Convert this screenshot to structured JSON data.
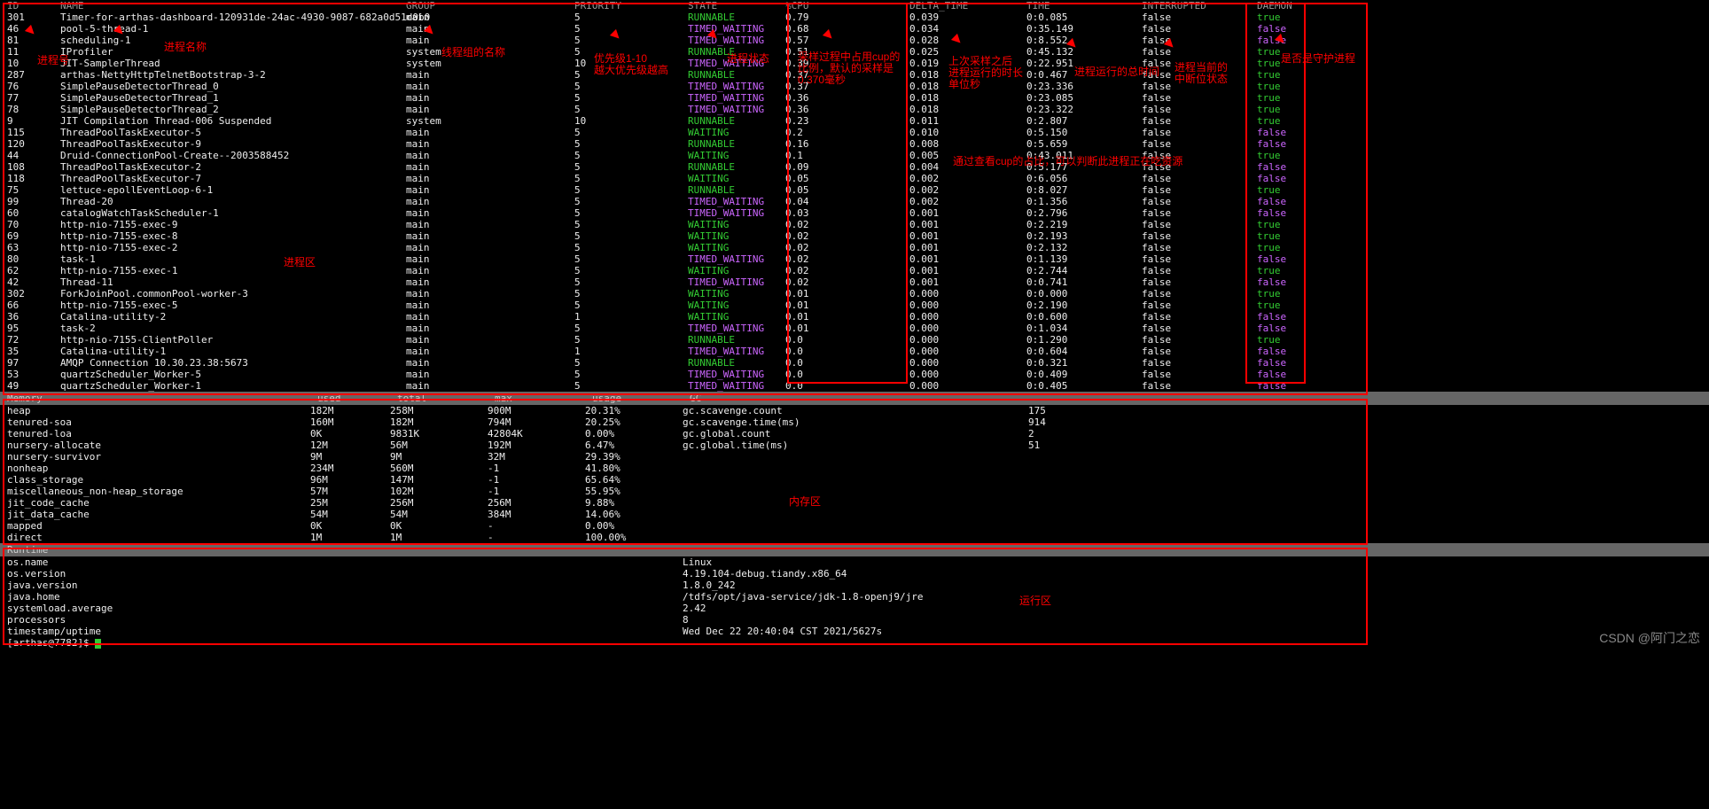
{
  "headers": [
    "ID",
    "NAME",
    "GROUP",
    "PRIORITY",
    "STATE",
    "%CPU",
    "DELTA_TIME",
    "TIME",
    "INTERRUPTED",
    "DAEMON"
  ],
  "threads": [
    {
      "id": "301",
      "name": "Timer-for-arthas-dashboard-120931de-24ac-4930-9087-682a0d51d0b0",
      "group": "main",
      "pri": "5",
      "state": "RUNNABLE",
      "sc": "green",
      "cpu": "0.79",
      "delta": "0.039",
      "time": "0:0.085",
      "int": "false",
      "dae": "true",
      "dc": "green"
    },
    {
      "id": "46",
      "name": "pool-5-thread-1",
      "group": "main",
      "pri": "5",
      "state": "TIMED_WAITING",
      "sc": "purple",
      "cpu": "0.68",
      "delta": "0.034",
      "time": "0:35.149",
      "int": "false",
      "dae": "false",
      "dc": "purple"
    },
    {
      "id": "81",
      "name": "scheduling-1",
      "group": "main",
      "pri": "5",
      "state": "TIMED_WAITING",
      "sc": "purple",
      "cpu": "0.57",
      "delta": "0.028",
      "time": "0:8.552",
      "int": "false",
      "dae": "false",
      "dc": "purple"
    },
    {
      "id": "11",
      "name": "IProfiler",
      "group": "system",
      "pri": "5",
      "state": "RUNNABLE",
      "sc": "green",
      "cpu": "0.51",
      "delta": "0.025",
      "time": "0:45.132",
      "int": "false",
      "dae": "true",
      "dc": "green"
    },
    {
      "id": "10",
      "name": "JIT-SamplerThread",
      "group": "system",
      "pri": "10",
      "state": "TIMED_WAITING",
      "sc": "purple",
      "cpu": "0.39",
      "delta": "0.019",
      "time": "0:22.951",
      "int": "false",
      "dae": "true",
      "dc": "green"
    },
    {
      "id": "287",
      "name": "arthas-NettyHttpTelnetBootstrap-3-2",
      "group": "main",
      "pri": "5",
      "state": "RUNNABLE",
      "sc": "green",
      "cpu": "0.37",
      "delta": "0.018",
      "time": "0:0.467",
      "int": "false",
      "dae": "true",
      "dc": "green"
    },
    {
      "id": "76",
      "name": "SimplePauseDetectorThread_0",
      "group": "main",
      "pri": "5",
      "state": "TIMED_WAITING",
      "sc": "purple",
      "cpu": "0.37",
      "delta": "0.018",
      "time": "0:23.336",
      "int": "false",
      "dae": "true",
      "dc": "green"
    },
    {
      "id": "77",
      "name": "SimplePauseDetectorThread_1",
      "group": "main",
      "pri": "5",
      "state": "TIMED_WAITING",
      "sc": "purple",
      "cpu": "0.36",
      "delta": "0.018",
      "time": "0:23.085",
      "int": "false",
      "dae": "true",
      "dc": "green"
    },
    {
      "id": "78",
      "name": "SimplePauseDetectorThread_2",
      "group": "main",
      "pri": "5",
      "state": "TIMED_WAITING",
      "sc": "purple",
      "cpu": "0.36",
      "delta": "0.018",
      "time": "0:23.322",
      "int": "false",
      "dae": "true",
      "dc": "green"
    },
    {
      "id": "9",
      "name": "JIT Compilation Thread-006 Suspended",
      "group": "system",
      "pri": "10",
      "state": "RUNNABLE",
      "sc": "green",
      "cpu": "0.23",
      "delta": "0.011",
      "time": "0:2.807",
      "int": "false",
      "dae": "true",
      "dc": "green"
    },
    {
      "id": "115",
      "name": "ThreadPoolTaskExecutor-5",
      "group": "main",
      "pri": "5",
      "state": "WAITING",
      "sc": "green",
      "cpu": "0.2",
      "delta": "0.010",
      "time": "0:5.150",
      "int": "false",
      "dae": "false",
      "dc": "purple"
    },
    {
      "id": "120",
      "name": "ThreadPoolTaskExecutor-9",
      "group": "main",
      "pri": "5",
      "state": "RUNNABLE",
      "sc": "green",
      "cpu": "0.16",
      "delta": "0.008",
      "time": "0:5.659",
      "int": "false",
      "dae": "false",
      "dc": "purple"
    },
    {
      "id": "44",
      "name": "Druid-ConnectionPool-Create--2003588452",
      "group": "main",
      "pri": "5",
      "state": "WAITING",
      "sc": "green",
      "cpu": "0.1",
      "delta": "0.005",
      "time": "0:43.011",
      "int": "false",
      "dae": "true",
      "dc": "green"
    },
    {
      "id": "108",
      "name": "ThreadPoolTaskExecutor-2",
      "group": "main",
      "pri": "5",
      "state": "RUNNABLE",
      "sc": "green",
      "cpu": "0.09",
      "delta": "0.004",
      "time": "0:5.177",
      "int": "false",
      "dae": "false",
      "dc": "purple"
    },
    {
      "id": "118",
      "name": "ThreadPoolTaskExecutor-7",
      "group": "main",
      "pri": "5",
      "state": "WAITING",
      "sc": "green",
      "cpu": "0.05",
      "delta": "0.002",
      "time": "0:6.056",
      "int": "false",
      "dae": "false",
      "dc": "purple"
    },
    {
      "id": "75",
      "name": "lettuce-epollEventLoop-6-1",
      "group": "main",
      "pri": "5",
      "state": "RUNNABLE",
      "sc": "green",
      "cpu": "0.05",
      "delta": "0.002",
      "time": "0:8.027",
      "int": "false",
      "dae": "true",
      "dc": "green"
    },
    {
      "id": "99",
      "name": "Thread-20",
      "group": "main",
      "pri": "5",
      "state": "TIMED_WAITING",
      "sc": "purple",
      "cpu": "0.04",
      "delta": "0.002",
      "time": "0:1.356",
      "int": "false",
      "dae": "false",
      "dc": "purple"
    },
    {
      "id": "60",
      "name": "catalogWatchTaskScheduler-1",
      "group": "main",
      "pri": "5",
      "state": "TIMED_WAITING",
      "sc": "purple",
      "cpu": "0.03",
      "delta": "0.001",
      "time": "0:2.796",
      "int": "false",
      "dae": "false",
      "dc": "purple"
    },
    {
      "id": "70",
      "name": "http-nio-7155-exec-9",
      "group": "main",
      "pri": "5",
      "state": "WAITING",
      "sc": "green",
      "cpu": "0.02",
      "delta": "0.001",
      "time": "0:2.219",
      "int": "false",
      "dae": "true",
      "dc": "green"
    },
    {
      "id": "69",
      "name": "http-nio-7155-exec-8",
      "group": "main",
      "pri": "5",
      "state": "WAITING",
      "sc": "green",
      "cpu": "0.02",
      "delta": "0.001",
      "time": "0:2.193",
      "int": "false",
      "dae": "true",
      "dc": "green"
    },
    {
      "id": "63",
      "name": "http-nio-7155-exec-2",
      "group": "main",
      "pri": "5",
      "state": "WAITING",
      "sc": "green",
      "cpu": "0.02",
      "delta": "0.001",
      "time": "0:2.132",
      "int": "false",
      "dae": "true",
      "dc": "green"
    },
    {
      "id": "80",
      "name": "task-1",
      "group": "main",
      "pri": "5",
      "state": "TIMED_WAITING",
      "sc": "purple",
      "cpu": "0.02",
      "delta": "0.001",
      "time": "0:1.139",
      "int": "false",
      "dae": "false",
      "dc": "purple"
    },
    {
      "id": "62",
      "name": "http-nio-7155-exec-1",
      "group": "main",
      "pri": "5",
      "state": "WAITING",
      "sc": "green",
      "cpu": "0.02",
      "delta": "0.001",
      "time": "0:2.744",
      "int": "false",
      "dae": "true",
      "dc": "green"
    },
    {
      "id": "42",
      "name": "Thread-11",
      "group": "main",
      "pri": "5",
      "state": "TIMED_WAITING",
      "sc": "purple",
      "cpu": "0.02",
      "delta": "0.001",
      "time": "0:0.741",
      "int": "false",
      "dae": "false",
      "dc": "purple"
    },
    {
      "id": "302",
      "name": "ForkJoinPool.commonPool-worker-3",
      "group": "main",
      "pri": "5",
      "state": "WAITING",
      "sc": "green",
      "cpu": "0.01",
      "delta": "0.000",
      "time": "0:0.000",
      "int": "false",
      "dae": "true",
      "dc": "green"
    },
    {
      "id": "66",
      "name": "http-nio-7155-exec-5",
      "group": "main",
      "pri": "5",
      "state": "WAITING",
      "sc": "green",
      "cpu": "0.01",
      "delta": "0.000",
      "time": "0:2.190",
      "int": "false",
      "dae": "true",
      "dc": "green"
    },
    {
      "id": "36",
      "name": "Catalina-utility-2",
      "group": "main",
      "pri": "1",
      "state": "WAITING",
      "sc": "green",
      "cpu": "0.01",
      "delta": "0.000",
      "time": "0:0.600",
      "int": "false",
      "dae": "false",
      "dc": "purple"
    },
    {
      "id": "95",
      "name": "task-2",
      "group": "main",
      "pri": "5",
      "state": "TIMED_WAITING",
      "sc": "purple",
      "cpu": "0.01",
      "delta": "0.000",
      "time": "0:1.034",
      "int": "false",
      "dae": "false",
      "dc": "purple"
    },
    {
      "id": "72",
      "name": "http-nio-7155-ClientPoller",
      "group": "main",
      "pri": "5",
      "state": "RUNNABLE",
      "sc": "green",
      "cpu": "0.0",
      "delta": "0.000",
      "time": "0:1.290",
      "int": "false",
      "dae": "true",
      "dc": "green"
    },
    {
      "id": "35",
      "name": "Catalina-utility-1",
      "group": "main",
      "pri": "1",
      "state": "TIMED_WAITING",
      "sc": "purple",
      "cpu": "0.0",
      "delta": "0.000",
      "time": "0:0.604",
      "int": "false",
      "dae": "false",
      "dc": "purple"
    },
    {
      "id": "97",
      "name": "AMQP Connection 10.30.23.38:5673",
      "group": "main",
      "pri": "5",
      "state": "RUNNABLE",
      "sc": "green",
      "cpu": "0.0",
      "delta": "0.000",
      "time": "0:0.321",
      "int": "false",
      "dae": "false",
      "dc": "purple"
    },
    {
      "id": "53",
      "name": "quartzScheduler_Worker-5",
      "group": "main",
      "pri": "5",
      "state": "TIMED_WAITING",
      "sc": "purple",
      "cpu": "0.0",
      "delta": "0.000",
      "time": "0:0.409",
      "int": "false",
      "dae": "false",
      "dc": "purple"
    },
    {
      "id": "49",
      "name": "quartzScheduler_Worker-1",
      "group": "main",
      "pri": "5",
      "state": "TIMED_WAITING",
      "sc": "purple",
      "cpu": "0.0",
      "delta": "0.000",
      "time": "0:0.405",
      "int": "false",
      "dae": "false",
      "dc": "purple"
    }
  ],
  "memHeader": [
    "Memory",
    "used",
    "total",
    "max",
    "usage",
    "GC"
  ],
  "mem": [
    {
      "n": "heap",
      "u": "182M",
      "t": "258M",
      "m": "900M",
      "p": "20.31%",
      "g": "gc.scavenge.count",
      "gv": "175"
    },
    {
      "n": "tenured-soa",
      "u": "160M",
      "t": "182M",
      "m": "794M",
      "p": "20.25%",
      "g": "gc.scavenge.time(ms)",
      "gv": "914"
    },
    {
      "n": "tenured-loa",
      "u": "0K",
      "t": "9831K",
      "m": "42804K",
      "p": "0.00%",
      "g": "gc.global.count",
      "gv": "2"
    },
    {
      "n": "nursery-allocate",
      "u": "12M",
      "t": "56M",
      "m": "192M",
      "p": "6.47%",
      "g": "gc.global.time(ms)",
      "gv": "51"
    },
    {
      "n": "nursery-survivor",
      "u": "9M",
      "t": "9M",
      "m": "32M",
      "p": "29.39%",
      "g": "",
      "gv": ""
    },
    {
      "n": "nonheap",
      "u": "234M",
      "t": "560M",
      "m": "-1",
      "p": "41.80%",
      "g": "",
      "gv": ""
    },
    {
      "n": "class_storage",
      "u": "96M",
      "t": "147M",
      "m": "-1",
      "p": "65.64%",
      "g": "",
      "gv": ""
    },
    {
      "n": "miscellaneous_non-heap_storage",
      "u": "57M",
      "t": "102M",
      "m": "-1",
      "p": "55.95%",
      "g": "",
      "gv": ""
    },
    {
      "n": "jit_code_cache",
      "u": "25M",
      "t": "256M",
      "m": "256M",
      "p": "9.88%",
      "g": "",
      "gv": ""
    },
    {
      "n": "jit_data_cache",
      "u": "54M",
      "t": "54M",
      "m": "384M",
      "p": "14.06%",
      "g": "",
      "gv": ""
    },
    {
      "n": "mapped",
      "u": "0K",
      "t": "0K",
      "m": "-",
      "p": "0.00%",
      "g": "",
      "gv": ""
    },
    {
      "n": "direct",
      "u": "1M",
      "t": "1M",
      "m": "-",
      "p": "100.00%",
      "g": "",
      "gv": ""
    }
  ],
  "runtimeHeader": "Runtime",
  "runtime": [
    {
      "n": "os.name",
      "v": "Linux"
    },
    {
      "n": "os.version",
      "v": "4.19.104-debug.tiandy.x86_64"
    },
    {
      "n": "java.version",
      "v": "1.8.0_242"
    },
    {
      "n": "java.home",
      "v": "/tdfs/opt/java-service/jdk-1.8-openj9/jre"
    },
    {
      "n": "systemload.average",
      "v": "2.42"
    },
    {
      "n": "processors",
      "v": "8"
    },
    {
      "n": "timestamp/uptime",
      "v": "Wed Dec 22 20:40:04 CST 2021/5627s"
    }
  ],
  "prompt": "[arthas@7782]$",
  "anno": {
    "id": "进程号",
    "name": "进程名称",
    "group": "线程组的名称",
    "pri": "优先级1-10\n越大优先级越高",
    "state": "进程状态",
    "cpu": "采样过程中占用cup的\n比例，默认的采样是\n0.370毫秒",
    "delta": "上次采样之后\n进程运行的时长\n单位秒",
    "time": "进程运行的总时间",
    "int": "进程当前的\n中断位状态",
    "dae": "是否是守护进程",
    "threadArea": "进程区",
    "memArea": "内存区",
    "runArea": "运行区",
    "tip": "通过查看cup的占比，可以判断此进程正在吃资源"
  },
  "watermark": "CSDN @阿门之恋"
}
